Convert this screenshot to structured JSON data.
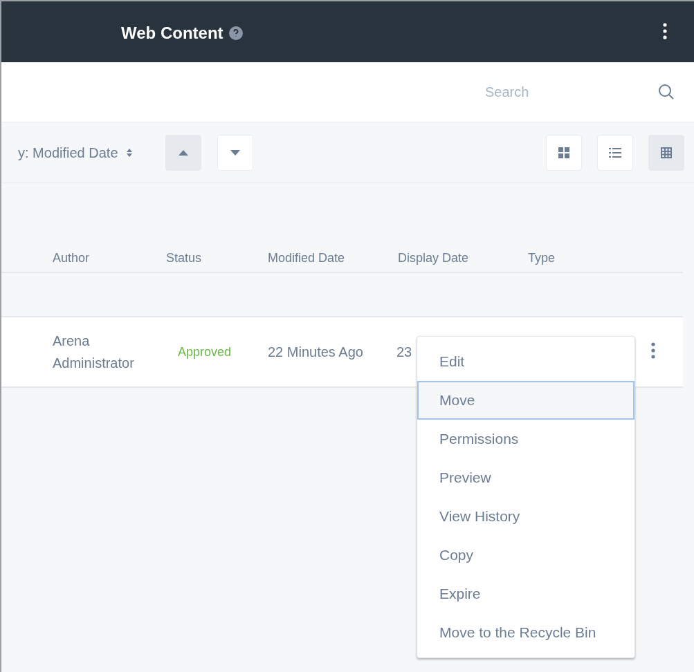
{
  "header": {
    "title": "Web Content"
  },
  "search": {
    "placeholder": "Search"
  },
  "toolbar": {
    "sort_label": "y: Modified Date",
    "sort_ascending": true,
    "views": [
      {
        "kind": "cards",
        "selected": false
      },
      {
        "kind": "list",
        "selected": false
      },
      {
        "kind": "table",
        "selected": true
      }
    ]
  },
  "table": {
    "columns": [
      "Author",
      "Status",
      "Modified Date",
      "Display Date",
      "Type"
    ],
    "rows": [
      {
        "author": "Arena Administrator",
        "status": "Approved",
        "modified": "22 Minutes Ago",
        "display": "23"
      }
    ]
  },
  "menu": {
    "items": [
      {
        "label": "Edit",
        "selected": false
      },
      {
        "label": "Move",
        "selected": true
      },
      {
        "label": "Permissions",
        "selected": false
      },
      {
        "label": "Preview",
        "selected": false
      },
      {
        "label": "View History",
        "selected": false
      },
      {
        "label": "Copy",
        "selected": false
      },
      {
        "label": "Expire",
        "selected": false
      },
      {
        "label": "Move to the Recycle Bin",
        "selected": false
      }
    ]
  }
}
